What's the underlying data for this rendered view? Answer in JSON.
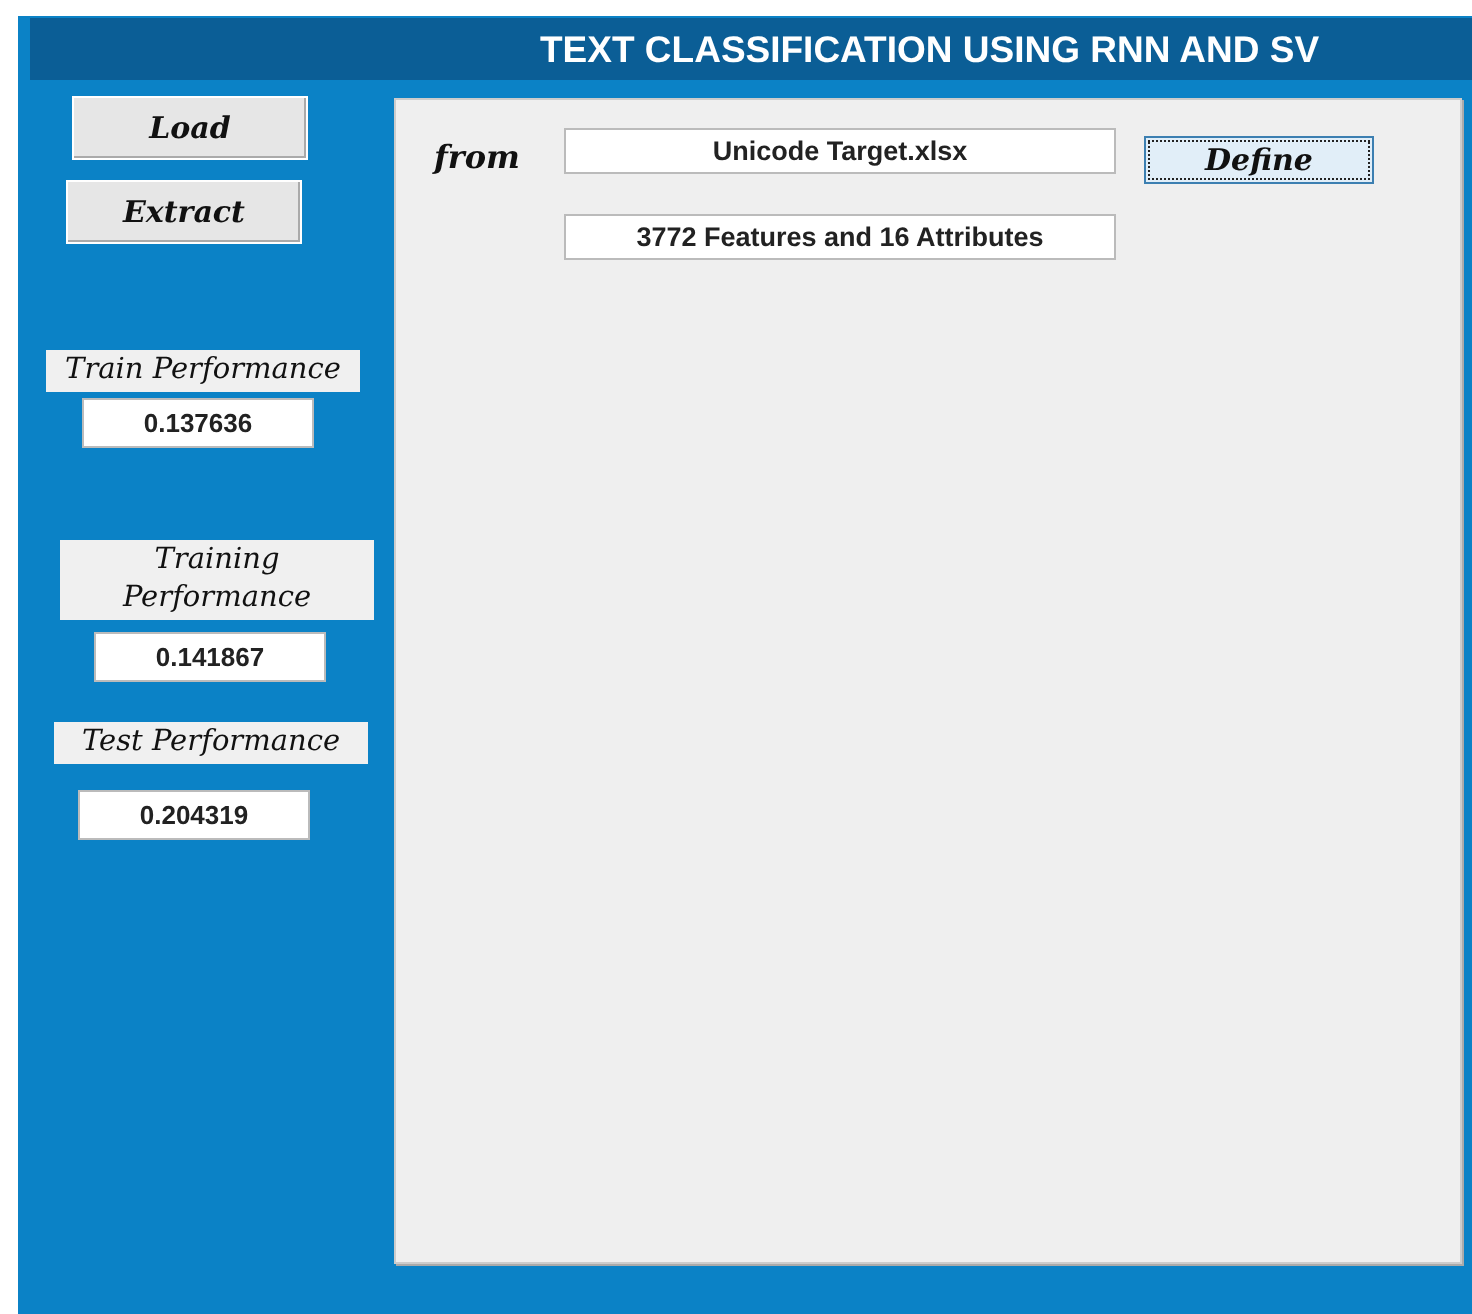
{
  "title": "TEXT CLASSIFICATION USING RNN AND SV",
  "actions": [
    {
      "label": "Load"
    },
    {
      "label": "Extract"
    }
  ],
  "metrics": [
    {
      "label": "Train Performance",
      "value": "0.137636"
    },
    {
      "label": "Training Performance",
      "value": "0.141867"
    },
    {
      "label": "Test Performance",
      "value": "0.204319"
    }
  ],
  "panel": {
    "source_label": "from",
    "file_field": {
      "value": "Unicode Target.xlsx"
    },
    "define_button": {
      "label": "Define",
      "focused": true
    },
    "info_field": {
      "value": "3772 Features and 16 Attributes"
    }
  }
}
